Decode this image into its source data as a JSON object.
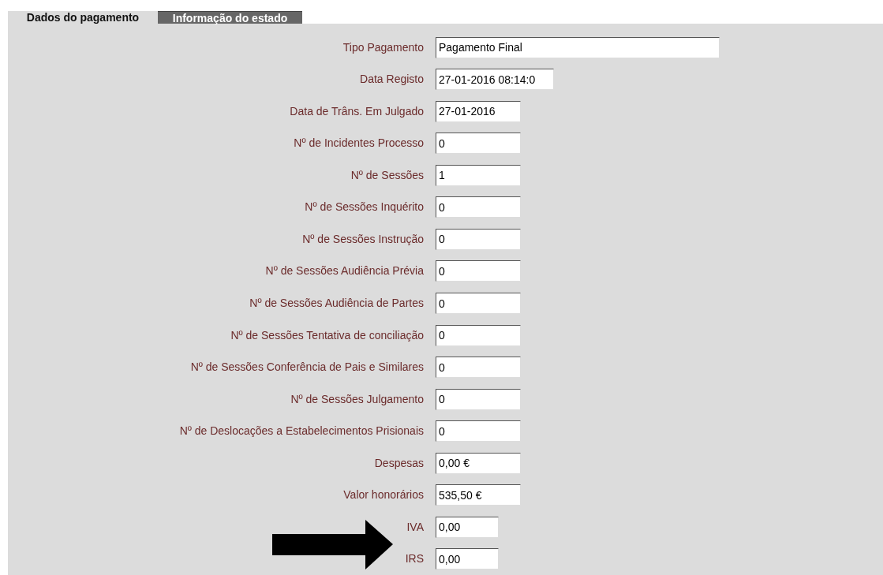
{
  "tabs": [
    {
      "label": "Dados do pagamento",
      "selected": true
    },
    {
      "label": "Informação do estado",
      "selected": false
    }
  ],
  "fields": [
    {
      "label": "Tipo Pagamento",
      "value": "Pagamento Final",
      "kind": "long"
    },
    {
      "label": "Data Registo",
      "value": "27-01-2016 08:14:0",
      "kind": "wide"
    },
    {
      "label": "Data de Trâns. Em Julgado",
      "value": "27-01-2016",
      "kind": "medium"
    },
    {
      "label": "Nº de Incidentes Processo",
      "value": "0",
      "kind": "medium"
    },
    {
      "label": "Nº de Sessões",
      "value": "1",
      "kind": "medium"
    },
    {
      "label": "Nº de Sessões Inquérito",
      "value": "0",
      "kind": "medium"
    },
    {
      "label": "Nº de Sessões Instrução",
      "value": "0",
      "kind": "medium"
    },
    {
      "label": "Nº de Sessões Audiência Prévia",
      "value": "0",
      "kind": "medium"
    },
    {
      "label": "Nº de Sessões Audiência de Partes",
      "value": "0",
      "kind": "medium"
    },
    {
      "label": "Nº de Sessões Tentativa de conciliação",
      "value": "0",
      "kind": "medium"
    },
    {
      "label": "Nº de Sessões Conferência de Pais e Similares",
      "value": "0",
      "kind": "medium"
    },
    {
      "label": "Nº de Sessões Julgamento",
      "value": "0",
      "kind": "medium"
    },
    {
      "label": "Nº de Deslocações a Estabelecimentos Prisionais",
      "value": "0",
      "kind": "medium"
    },
    {
      "label": "Despesas",
      "value": "0,00 €",
      "kind": "medium"
    },
    {
      "label": "Valor honorários",
      "value": "535,50 €",
      "kind": "medium"
    },
    {
      "label": "IVA",
      "value": "0,00",
      "kind": "short"
    },
    {
      "label": "IRS",
      "value": "0,00",
      "kind": "short"
    }
  ],
  "annotation": {
    "kind": "arrow"
  }
}
